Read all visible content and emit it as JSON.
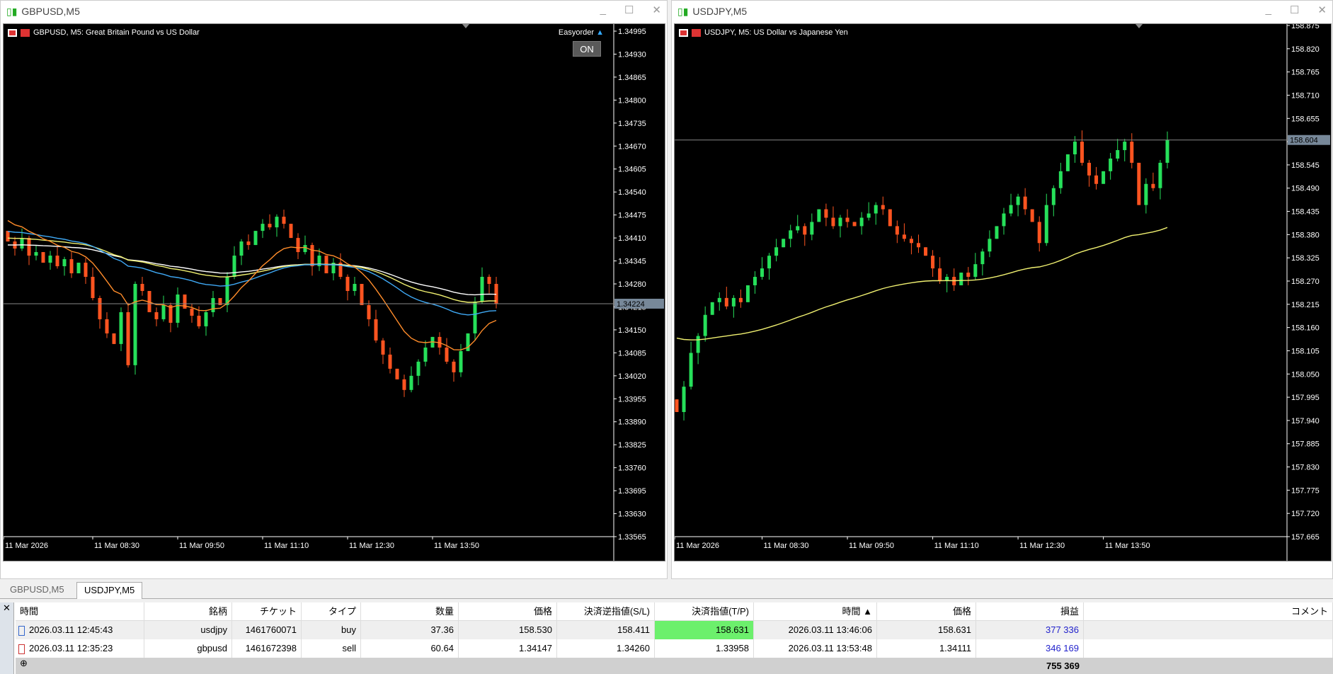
{
  "windows": [
    {
      "title": "GBPUSD,M5",
      "legend": "GBPUSD, M5:  Great Britain Pound vs US Dollar",
      "easyorder": "Easyorder",
      "on_button": "ON",
      "price_labels": [
        "1.34995",
        "1.34930",
        "1.34865",
        "1.34800",
        "1.34735",
        "1.34670",
        "1.34605",
        "1.34540",
        "1.34475",
        "1.34410",
        "1.34345",
        "1.34280",
        "1.34215",
        "1.34150",
        "1.34085",
        "1.34020",
        "1.33955",
        "1.33890",
        "1.33825",
        "1.33760",
        "1.33695",
        "1.33630",
        "1.33565"
      ],
      "current_price": "1.34224",
      "time_labels": [
        "11 Mar 2026",
        "11 Mar 08:30",
        "11 Mar 09:50",
        "11 Mar 11:10",
        "11 Mar 12:30",
        "11 Mar 13:50"
      ]
    },
    {
      "title": "USDJPY,M5",
      "legend": "USDJPY, M5:  US Dollar vs Japanese Yen",
      "price_labels": [
        "158.875",
        "158.820",
        "158.765",
        "158.710",
        "158.655",
        "158.600",
        "158.545",
        "158.490",
        "158.435",
        "158.380",
        "158.325",
        "158.270",
        "158.215",
        "158.160",
        "158.105",
        "158.050",
        "157.995",
        "157.940",
        "157.885",
        "157.830",
        "157.775",
        "157.720",
        "157.665"
      ],
      "current_price": "158.604",
      "time_labels": [
        "11 Mar 2026",
        "11 Mar 08:30",
        "11 Mar 09:50",
        "11 Mar 11:10",
        "11 Mar 12:30",
        "11 Mar 13:50"
      ]
    }
  ],
  "chart_data": [
    {
      "type": "candlestick",
      "symbol": "GBPUSD",
      "ylim": [
        1.33565,
        1.34995
      ],
      "closes": [
        1.344,
        1.3438,
        1.3441,
        1.3436,
        1.3437,
        1.3434,
        1.3436,
        1.3433,
        1.3435,
        1.3431,
        1.3434,
        1.343,
        1.3424,
        1.3418,
        1.3414,
        1.3411,
        1.342,
        1.3405,
        1.3428,
        1.3426,
        1.342,
        1.3418,
        1.3422,
        1.3417,
        1.3425,
        1.3421,
        1.3419,
        1.3416,
        1.342,
        1.3424,
        1.3422,
        1.343,
        1.3436,
        1.344,
        1.3439,
        1.3443,
        1.3445,
        1.3444,
        1.3447,
        1.3445,
        1.3441,
        1.3437,
        1.3439,
        1.3433,
        1.3436,
        1.3431,
        1.3434,
        1.343,
        1.3426,
        1.3428,
        1.3422,
        1.3418,
        1.3412,
        1.3408,
        1.3404,
        1.3401,
        1.3398,
        1.3402,
        1.3406,
        1.341,
        1.3413,
        1.341,
        1.3406,
        1.3403,
        1.3409,
        1.3414,
        1.3423,
        1.343,
        1.3428,
        1.34224
      ],
      "moving_averages": [
        {
          "color": "#ffffff",
          "period": 80,
          "seed": 1.3439
        },
        {
          "color": "#f0f070",
          "period": 60,
          "seed": 1.3441
        },
        {
          "color": "#3fa9f5",
          "period": 40,
          "seed": 1.3443
        },
        {
          "color": "#ff8c2a",
          "period": 12,
          "seed": 1.3447
        }
      ]
    },
    {
      "type": "candlestick",
      "symbol": "USDJPY",
      "ylim": [
        157.665,
        158.875
      ],
      "closes": [
        157.96,
        158.02,
        158.1,
        158.14,
        158.19,
        158.22,
        158.23,
        158.21,
        158.23,
        158.22,
        158.26,
        158.28,
        158.3,
        158.33,
        158.35,
        158.37,
        158.39,
        158.4,
        158.38,
        158.41,
        158.44,
        158.42,
        158.4,
        158.42,
        158.41,
        158.4,
        158.42,
        158.43,
        158.45,
        158.44,
        158.4,
        158.38,
        158.37,
        158.36,
        158.35,
        158.33,
        158.3,
        158.27,
        158.28,
        158.26,
        158.29,
        158.28,
        158.31,
        158.34,
        158.37,
        158.4,
        158.43,
        158.45,
        158.47,
        158.44,
        158.41,
        158.36,
        158.45,
        158.49,
        158.53,
        158.57,
        158.6,
        158.55,
        158.52,
        158.5,
        158.53,
        158.56,
        158.58,
        158.6,
        158.55,
        158.45,
        158.5,
        158.49,
        158.55,
        158.604
      ],
      "moving_averages": [
        {
          "color": "#f0f070",
          "period": 70,
          "seed": 158.14
        }
      ]
    }
  ],
  "tabs": [
    "GBPUSD,M5",
    "USDJPY,M5"
  ],
  "table": {
    "headers": [
      "時間",
      "銘柄",
      "チケット",
      "タイプ",
      "数量",
      "価格",
      "決済逆指値(S/L)",
      "決済指値(T/P)",
      "時間 ▲",
      "価格",
      "損益",
      "コメント"
    ],
    "rows": [
      [
        "2026.03.11 12:45:43",
        "usdjpy",
        "1461760071",
        "buy",
        "37.36",
        "158.530",
        "158.411",
        "158.631",
        "2026.03.11 13:46:06",
        "158.631",
        "377 336",
        ""
      ],
      [
        "2026.03.11 12:35:23",
        "gbpusd",
        "1461672398",
        "sell",
        "60.64",
        "1.34147",
        "1.34260",
        "1.33958",
        "2026.03.11 13:53:48",
        "1.34111",
        "346 169",
        ""
      ]
    ],
    "total": "755 369",
    "close_label": "✕"
  },
  "colors": {
    "bull": "#26e05a",
    "bear": "#ff5420",
    "tp_highlight": "#6cf06c",
    "profit": "#2222cc"
  }
}
